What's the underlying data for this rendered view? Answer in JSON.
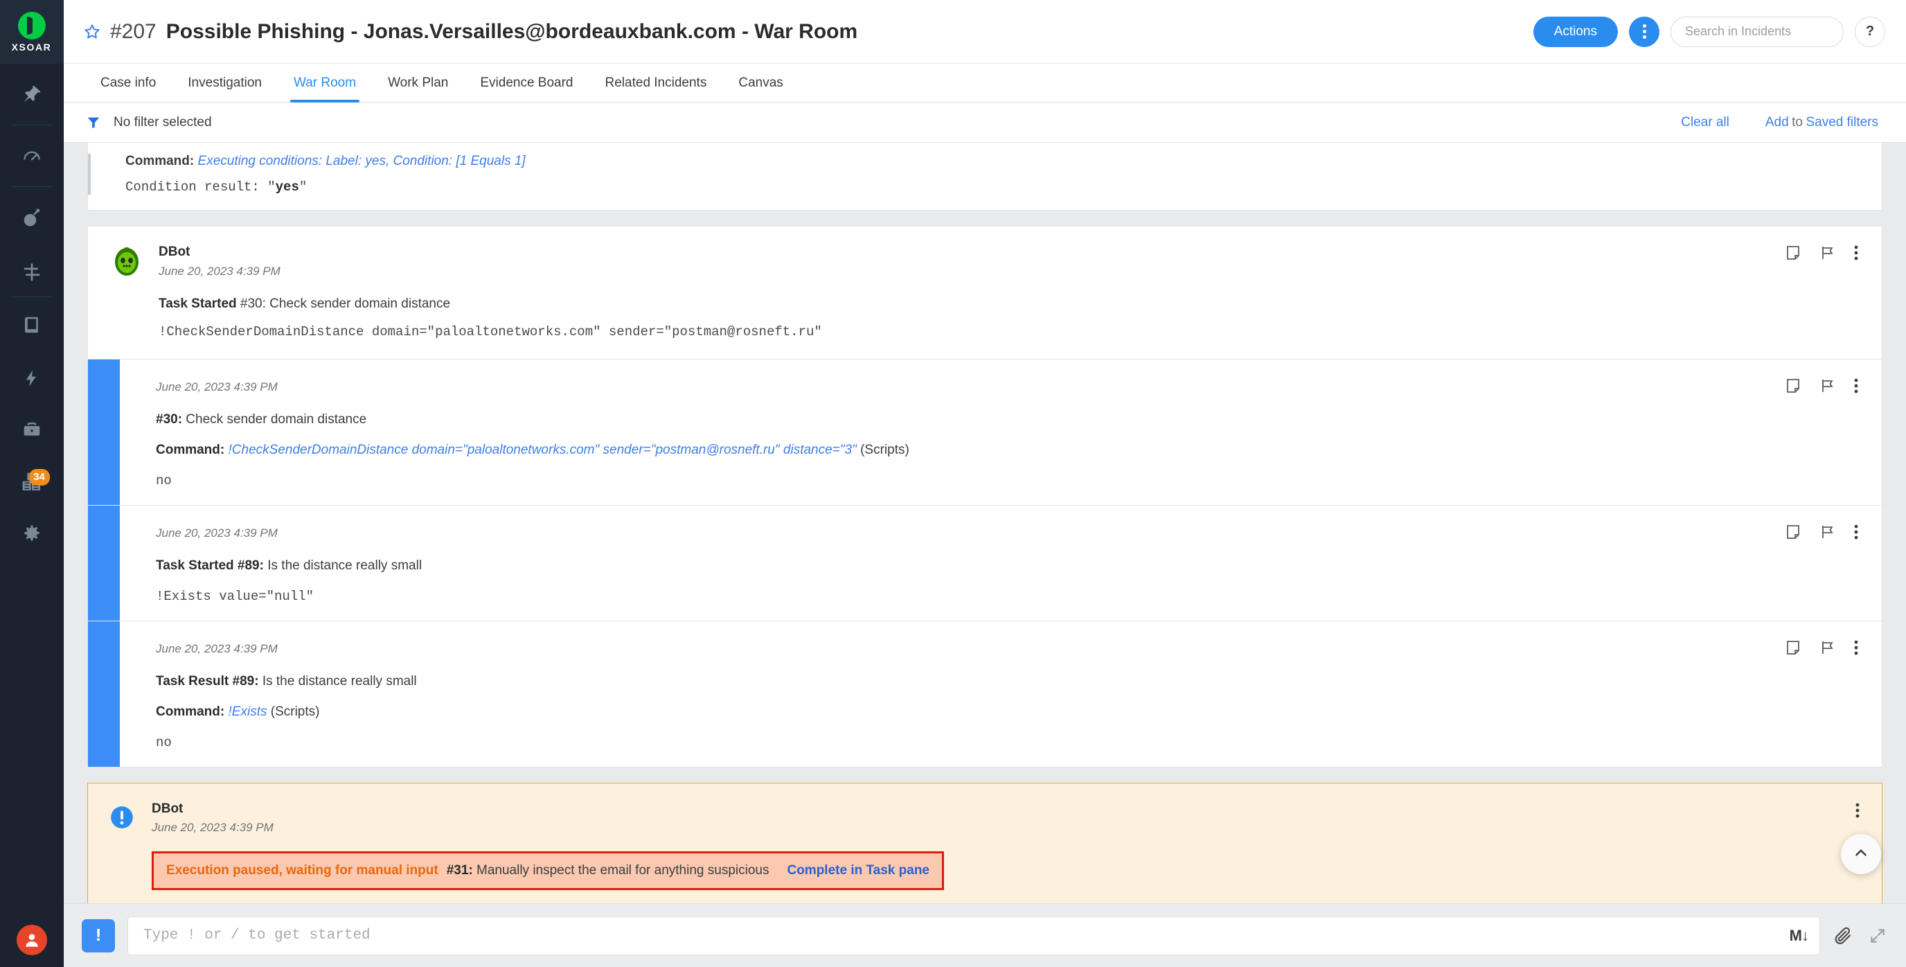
{
  "sidebar": {
    "logo_label": "XSOAR",
    "items": [
      {
        "name": "pin",
        "icon": "pin-icon"
      },
      {
        "name": "dashboard",
        "icon": "gauge-icon"
      },
      {
        "name": "threat-intel",
        "icon": "bomb-icon"
      },
      {
        "name": "playbooks-nav",
        "icon": "signpost-icon"
      },
      {
        "name": "reports",
        "icon": "book-icon"
      },
      {
        "name": "automation",
        "icon": "lightning-icon"
      },
      {
        "name": "jobs",
        "icon": "briefcase-icon"
      },
      {
        "name": "marketplace",
        "icon": "boxes-icon",
        "badge": "34"
      },
      {
        "name": "settings",
        "icon": "gear-icon"
      }
    ],
    "avatar": "user-avatar"
  },
  "header": {
    "incident_id": "#207",
    "title": "Possible Phishing - Jonas.Versailles@bordeauxbank.com - War Room",
    "actions_label": "Actions",
    "search_placeholder": "Search in Incidents",
    "help_label": "?"
  },
  "tabs": [
    {
      "label": "Case info",
      "active": false
    },
    {
      "label": "Investigation",
      "active": false
    },
    {
      "label": "War Room",
      "active": true
    },
    {
      "label": "Work Plan",
      "active": false
    },
    {
      "label": "Evidence Board",
      "active": false
    },
    {
      "label": "Related Incidents",
      "active": false
    },
    {
      "label": "Canvas",
      "active": false
    }
  ],
  "filterbar": {
    "text": "No filter selected",
    "clear_all": "Clear all",
    "add": "Add",
    "to": "to",
    "saved_filters": "Saved filters"
  },
  "feed": {
    "partial": {
      "command_label": "Command:",
      "command_value": "Executing conditions: Label: yes, Condition: [1 Equals 1]",
      "result_prefix": "Condition result: \"",
      "result_value": "yes",
      "result_suffix": "\""
    },
    "dbot_message": {
      "author": "DBot",
      "time": "June 20, 2023 4:39 PM",
      "status_label": "Task Started",
      "task": "#30: Check sender domain distance",
      "command_mono": "!CheckSenderDomainDistance domain=\"paloaltonetworks.com\" sender=\"postman@rosneft.ru\""
    },
    "entries": [
      {
        "time": "June 20, 2023 4:39 PM",
        "task_id": "#30:",
        "task_name": " Check sender domain distance",
        "command_label": "Command:",
        "command_value": "!CheckSenderDomainDistance domain=\"paloaltonetworks.com\" sender=\"postman@rosneft.ru\" distance=\"3\"",
        "command_source": "(Scripts)",
        "output": "no"
      },
      {
        "time": "June 20, 2023 4:39 PM",
        "status_label": "Task Started",
        "task_id": " #89:",
        "task_name": " Is the distance really small",
        "mono": "!Exists value=\"null\""
      },
      {
        "time": "June 20, 2023 4:39 PM",
        "status_label": "Task Result",
        "task_id": " #89:",
        "task_name": " Is the distance really small",
        "command_label": "Command:",
        "command_value": "!Exists",
        "command_source": "(Scripts)",
        "output": "no"
      }
    ],
    "warning": {
      "author": "DBot",
      "time": "June 20, 2023 4:39 PM",
      "paused_text": "Execution paused, waiting for manual input",
      "task_id": "#31:",
      "task_text": " Manually inspect the email for anything suspicious",
      "link": "Complete in Task pane"
    }
  },
  "composer": {
    "bang_label": "!",
    "placeholder": "Type ! or / to get started",
    "markdown_label": "M",
    "attach_icon": "paperclip-icon",
    "expand_icon": "expand-icon"
  },
  "colors": {
    "accent_blue": "#2b8cf0",
    "bar_blue": "#3b8ef5",
    "warning_bg": "#fdf0dd",
    "warning_border": "#e8a93c",
    "alert_box_bg": "#fbc8b0",
    "alert_box_border": "#e01b11",
    "alert_text": "#e8690f",
    "badge_orange": "#f08c1a",
    "logo_green": "#00cc44"
  }
}
